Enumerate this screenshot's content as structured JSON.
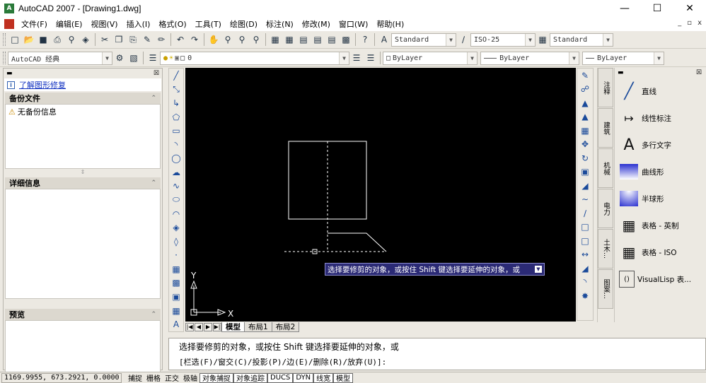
{
  "window": {
    "app_icon": "autocad-logo-icon",
    "title": "AutoCAD 2007 - [Drawing1.dwg]",
    "controls": [
      "minimize-icon",
      "maximize-icon",
      "close-icon"
    ]
  },
  "menu": {
    "items": [
      "文件(F)",
      "编辑(E)",
      "视图(V)",
      "插入(I)",
      "格式(O)",
      "工具(T)",
      "绘图(D)",
      "标注(N)",
      "修改(M)",
      "窗口(W)",
      "帮助(H)"
    ],
    "mdi_controls": [
      "_",
      "▫",
      "x"
    ]
  },
  "toolbar1": {
    "text_style": "Standard",
    "dim_style": "ISO-25",
    "table_style": "Standard"
  },
  "toolbar2": {
    "workspace": "AutoCAD 经典",
    "layer_value": "0",
    "color": "ByLayer",
    "linetype": "ByLayer",
    "lineweight": "ByLayer"
  },
  "left_panel": {
    "info_link": "了解图形修复",
    "backup_header": "备份文件",
    "backup_item": "无备份信息",
    "details_header": "详细信息",
    "preview_header": "预览"
  },
  "draw_toolbar": {
    "icons": [
      "line-icon",
      "construction-line-icon",
      "polyline-icon",
      "polygon-icon",
      "rectangle-icon",
      "arc-icon",
      "circle-icon",
      "revision-cloud-icon",
      "spline-icon",
      "ellipse-icon",
      "ellipse-arc-icon",
      "insert-block-icon",
      "make-block-icon",
      "point-icon",
      "hatch-icon",
      "gradient-icon",
      "region-icon",
      "table-icon",
      "multiline-text-icon"
    ]
  },
  "canvas": {
    "tooltip": "选择要修剪的对象，或按住 Shift 键选择要延伸的对象，或",
    "ucs_y": "Y",
    "ucs_x": "X"
  },
  "layout_tabs": {
    "tabs": [
      "模型",
      "布局1",
      "布局2"
    ],
    "active": "模型"
  },
  "modify_toolbar": {
    "icons": [
      "erase-icon",
      "copy-icon",
      "mirror-icon",
      "offset-icon",
      "array-icon",
      "move-icon",
      "rotate-icon",
      "scale-icon",
      "stretch-icon",
      "trim-icon",
      "extend-icon",
      "break-at-point-icon",
      "break-icon",
      "join-icon",
      "chamfer-icon",
      "fillet-icon",
      "explode-icon"
    ]
  },
  "tool_palette": {
    "vertical_tabs": [
      "注释",
      "建筑",
      "机械",
      "电力",
      "土木...",
      "图案..."
    ],
    "tools": [
      {
        "label": "直线",
        "icon": "line-tool-icon"
      },
      {
        "label": "线性标注",
        "icon": "linear-dimension-icon"
      },
      {
        "label": "多行文字",
        "icon": "mtext-icon"
      },
      {
        "label": "曲线形",
        "icon": "curved-gradient-icon"
      },
      {
        "label": "半球形",
        "icon": "hemispherical-gradient-icon"
      },
      {
        "label": "表格 - 英制",
        "icon": "table-imperial-icon"
      },
      {
        "label": "表格 - ISO",
        "icon": "table-iso-icon"
      },
      {
        "label": "VisualLisp 表...",
        "icon": "visuallisp-icon"
      }
    ]
  },
  "command_line": {
    "line1": "选择要修剪的对象，或按住 Shift 键选择要延伸的对象，或",
    "line2": "[栏选(F)/窗交(C)/投影(P)/边(E)/删除(R)/放弃(U)]:"
  },
  "status_bar": {
    "coords": "1169.9955, 673.2921, 0.0000",
    "toggles": [
      {
        "label": "捕捉",
        "on": false
      },
      {
        "label": "栅格",
        "on": false
      },
      {
        "label": "正交",
        "on": false
      },
      {
        "label": "极轴",
        "on": false
      },
      {
        "label": "对象捕捉",
        "on": true
      },
      {
        "label": "对象追踪",
        "on": true
      },
      {
        "label": "DUCS",
        "on": true
      },
      {
        "label": "DYN",
        "on": true
      },
      {
        "label": "线宽",
        "on": true
      },
      {
        "label": "模型",
        "on": true
      }
    ]
  },
  "colors": {
    "canvas_bg": "#000000",
    "tooltip_bg": "#2b2a75",
    "link": "#1030c0",
    "drawing": "#ffffff"
  }
}
